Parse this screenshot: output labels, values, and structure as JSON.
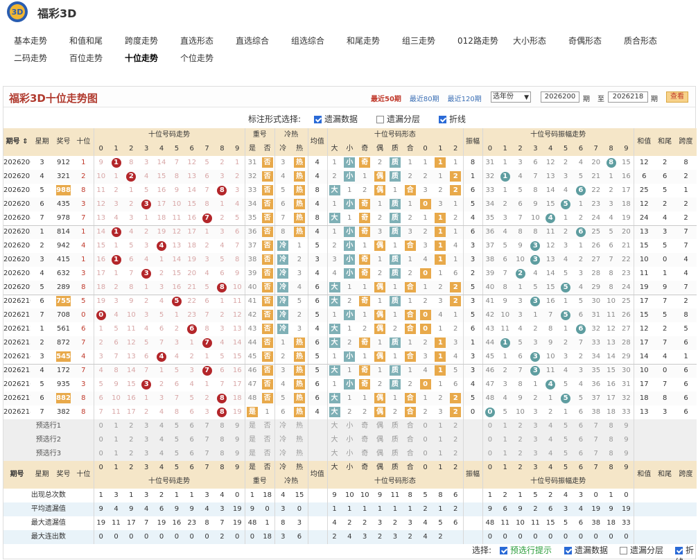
{
  "site": {
    "title": "福彩3D"
  },
  "nav": {
    "row1": [
      "基本走势",
      "和值和尾",
      "跨度走势",
      "直选形态",
      "直选综合",
      "组选综合",
      "和尾走势",
      "组三走势",
      "012路走势",
      "大小形态",
      "奇偶形态",
      "质合形态"
    ],
    "row2": [
      "二码走势",
      "百位走势",
      "十位走势",
      "个位走势"
    ],
    "active": "十位走势"
  },
  "panel": {
    "title": "福彩3D十位走势图",
    "periods": [
      "最近50期",
      "最近80期",
      "最近120期"
    ],
    "selected_period": "最近50期",
    "year_select": "选年份",
    "start": "2026200",
    "end": "2026218",
    "label_qi": "期",
    "label_to": "至",
    "query": "查看"
  },
  "options": {
    "label": "标注形式选择:",
    "items": [
      {
        "label": "遗漏数据",
        "checked": true
      },
      {
        "label": "遗漏分层",
        "checked": false
      },
      {
        "label": "折线",
        "checked": true
      }
    ]
  },
  "header": {
    "qihao": "期号",
    "week": "星期",
    "prize": "奖号",
    "ten": "十位",
    "trend": "十位号码走势",
    "chong": "重号",
    "shi": "是",
    "fou": "否",
    "lengre": "冷热",
    "leng": "冷",
    "re": "热",
    "avg": "均值",
    "shape": "十位号码形态",
    "da": "大",
    "xiao": "小",
    "ji": "奇",
    "ou": "偶",
    "zhi": "质",
    "he": "合",
    "amp": "振幅",
    "amptrend": "十位号码振幅走势",
    "sum": "和值",
    "tail": "和尾",
    "span": "跨度"
  },
  "digits": [
    "0",
    "1",
    "2",
    "3",
    "4",
    "5",
    "6",
    "7",
    "8",
    "9"
  ],
  "d012": [
    "0",
    "1",
    "2"
  ],
  "rows": [
    {
      "q": "2026200",
      "w": "3",
      "n": "912",
      "t": "1",
      "miss": [
        "9",
        "1",
        "8",
        "3",
        "14",
        "7",
        "12",
        "5",
        "2",
        "1"
      ],
      "ch": [
        "31",
        "否"
      ],
      "lr": [
        "3",
        "热"
      ],
      "avg": "4",
      "dx": [
        "1",
        "小"
      ],
      "jo": [
        "奇",
        "2"
      ],
      "zh": [
        "质",
        "1"
      ],
      "r012": [
        "1",
        "1",
        "1"
      ],
      "amp": "8",
      "am": [
        "31",
        "1",
        "3",
        "6",
        "12",
        "2",
        "4",
        "20",
        "8",
        "15"
      ],
      "sum": "12",
      "tail": "2",
      "span": "8"
    },
    {
      "q": "2026201",
      "w": "4",
      "n": "321",
      "t": "2",
      "miss": [
        "10",
        "1",
        "2",
        "4",
        "15",
        "8",
        "13",
        "6",
        "3",
        "2"
      ],
      "ch": [
        "32",
        "否"
      ],
      "lr": [
        "4",
        "热"
      ],
      "avg": "4",
      "dx": [
        "2",
        "小"
      ],
      "jo": [
        "1",
        "偶"
      ],
      "zh": [
        "质",
        "2"
      ],
      "r012": [
        "2",
        "1",
        "2"
      ],
      "amp": "1",
      "am": [
        "32",
        "1",
        "4",
        "7",
        "13",
        "3",
        "5",
        "21",
        "1",
        "16"
      ],
      "sum": "6",
      "tail": "6",
      "span": "2"
    },
    {
      "q": "2026202",
      "w": "5",
      "n": "988",
      "t": "8",
      "miss": [
        "11",
        "2",
        "1",
        "5",
        "16",
        "9",
        "14",
        "7",
        "8",
        "3"
      ],
      "ch": [
        "33",
        "否"
      ],
      "lr": [
        "5",
        "热"
      ],
      "avg": "8",
      "dx": [
        "大",
        "1"
      ],
      "jo": [
        "2",
        "偶"
      ],
      "zh": [
        "1",
        "合"
      ],
      "r012": [
        "3",
        "2",
        "2"
      ],
      "amp": "6",
      "am": [
        "33",
        "1",
        "5",
        "8",
        "14",
        "4",
        "6",
        "22",
        "2",
        "17"
      ],
      "sum": "25",
      "tail": "5",
      "span": "1"
    },
    {
      "q": "2026203",
      "w": "6",
      "n": "435",
      "t": "3",
      "miss": [
        "12",
        "3",
        "2",
        "3",
        "17",
        "10",
        "15",
        "8",
        "1",
        "4"
      ],
      "ch": [
        "34",
        "否"
      ],
      "lr": [
        "6",
        "热"
      ],
      "avg": "4",
      "dx": [
        "1",
        "小"
      ],
      "jo": [
        "奇",
        "1"
      ],
      "zh": [
        "质",
        "1"
      ],
      "r012": [
        "0",
        "3",
        "1"
      ],
      "amp": "5",
      "am": [
        "34",
        "2",
        "6",
        "9",
        "15",
        "5",
        "1",
        "23",
        "3",
        "18"
      ],
      "sum": "12",
      "tail": "2",
      "span": "2"
    },
    {
      "q": "2026204",
      "w": "7",
      "n": "978",
      "t": "7",
      "miss": [
        "13",
        "4",
        "3",
        "1",
        "18",
        "11",
        "16",
        "7",
        "2",
        "5"
      ],
      "ch": [
        "35",
        "否"
      ],
      "lr": [
        "7",
        "热"
      ],
      "avg": "8",
      "dx": [
        "大",
        "1"
      ],
      "jo": [
        "奇",
        "2"
      ],
      "zh": [
        "质",
        "2"
      ],
      "r012": [
        "1",
        "1",
        "2"
      ],
      "amp": "4",
      "am": [
        "35",
        "3",
        "7",
        "10",
        "4",
        "1",
        "2",
        "24",
        "4",
        "19"
      ],
      "sum": "24",
      "tail": "4",
      "span": "2"
    },
    {
      "q": "2026205",
      "w": "1",
      "n": "814",
      "t": "1",
      "miss": [
        "14",
        "1",
        "4",
        "2",
        "19",
        "12",
        "17",
        "1",
        "3",
        "6"
      ],
      "ch": [
        "36",
        "否"
      ],
      "lr": [
        "8",
        "热"
      ],
      "avg": "4",
      "dx": [
        "1",
        "小"
      ],
      "jo": [
        "奇",
        "3"
      ],
      "zh": [
        "质",
        "3"
      ],
      "r012": [
        "2",
        "1",
        "1"
      ],
      "amp": "6",
      "am": [
        "36",
        "4",
        "8",
        "8",
        "11",
        "2",
        "6",
        "25",
        "5",
        "20"
      ],
      "sum": "13",
      "tail": "3",
      "span": "7"
    },
    {
      "q": "2026206",
      "w": "2",
      "n": "942",
      "t": "4",
      "miss": [
        "15",
        "1",
        "5",
        "3",
        "4",
        "13",
        "18",
        "2",
        "4",
        "7"
      ],
      "ch": [
        "37",
        "否"
      ],
      "lr": [
        "冷",
        "1"
      ],
      "avg": "5",
      "dx": [
        "2",
        "小"
      ],
      "jo": [
        "1",
        "偶"
      ],
      "zh": [
        "1",
        "合"
      ],
      "r012": [
        "3",
        "1",
        "4"
      ],
      "amp": "3",
      "am": [
        "37",
        "5",
        "9",
        "3",
        "12",
        "3",
        "1",
        "26",
        "6",
        "21"
      ],
      "sum": "15",
      "tail": "5",
      "span": "7"
    },
    {
      "q": "2026207",
      "w": "3",
      "n": "415",
      "t": "1",
      "miss": [
        "16",
        "1",
        "6",
        "4",
        "1",
        "14",
        "19",
        "3",
        "5",
        "8"
      ],
      "ch": [
        "38",
        "否"
      ],
      "lr": [
        "冷",
        "2"
      ],
      "avg": "3",
      "dx": [
        "3",
        "小"
      ],
      "jo": [
        "奇",
        "1"
      ],
      "zh": [
        "质",
        "1"
      ],
      "r012": [
        "4",
        "1",
        "1"
      ],
      "amp": "3",
      "am": [
        "38",
        "6",
        "10",
        "3",
        "13",
        "4",
        "2",
        "27",
        "7",
        "22"
      ],
      "sum": "10",
      "tail": "0",
      "span": "4"
    },
    {
      "q": "2026208",
      "w": "4",
      "n": "632",
      "t": "3",
      "miss": [
        "17",
        "1",
        "7",
        "3",
        "2",
        "15",
        "20",
        "4",
        "6",
        "9"
      ],
      "ch": [
        "39",
        "否"
      ],
      "lr": [
        "冷",
        "3"
      ],
      "avg": "4",
      "dx": [
        "4",
        "小"
      ],
      "jo": [
        "奇",
        "2"
      ],
      "zh": [
        "质",
        "2"
      ],
      "r012": [
        "0",
        "1",
        "6"
      ],
      "amp": "2",
      "am": [
        "39",
        "7",
        "2",
        "4",
        "14",
        "5",
        "3",
        "28",
        "8",
        "23"
      ],
      "sum": "11",
      "tail": "1",
      "span": "4"
    },
    {
      "q": "2026209",
      "w": "5",
      "n": "289",
      "t": "8",
      "miss": [
        "18",
        "2",
        "8",
        "1",
        "3",
        "16",
        "21",
        "5",
        "8",
        "10"
      ],
      "ch": [
        "40",
        "否"
      ],
      "lr": [
        "冷",
        "4"
      ],
      "avg": "6",
      "dx": [
        "大",
        "1"
      ],
      "jo": [
        "1",
        "偶"
      ],
      "zh": [
        "1",
        "合"
      ],
      "r012": [
        "1",
        "2",
        "2"
      ],
      "amp": "5",
      "am": [
        "40",
        "8",
        "1",
        "5",
        "15",
        "5",
        "4",
        "29",
        "8",
        "24"
      ],
      "sum": "19",
      "tail": "9",
      "span": "7"
    },
    {
      "q": "2026210",
      "w": "6",
      "n": "755",
      "t": "5",
      "miss": [
        "19",
        "3",
        "9",
        "2",
        "4",
        "5",
        "22",
        "6",
        "1",
        "11"
      ],
      "ch": [
        "41",
        "否"
      ],
      "lr": [
        "冷",
        "5"
      ],
      "avg": "6",
      "dx": [
        "大",
        "2"
      ],
      "jo": [
        "奇",
        "1"
      ],
      "zh": [
        "质",
        "1"
      ],
      "r012": [
        "2",
        "3",
        "2"
      ],
      "amp": "3",
      "am": [
        "41",
        "9",
        "3",
        "3",
        "16",
        "1",
        "5",
        "30",
        "10",
        "25"
      ],
      "sum": "17",
      "tail": "7",
      "span": "2"
    },
    {
      "q": "2026211",
      "w": "7",
      "n": "708",
      "t": "0",
      "miss": [
        "0",
        "4",
        "10",
        "3",
        "5",
        "1",
        "23",
        "7",
        "2",
        "12"
      ],
      "ch": [
        "42",
        "否"
      ],
      "lr": [
        "冷",
        "2"
      ],
      "avg": "5",
      "dx": [
        "1",
        "小"
      ],
      "jo": [
        "1",
        "偶"
      ],
      "zh": [
        "1",
        "合"
      ],
      "r012": [
        "0",
        "4",
        "1"
      ],
      "amp": "5",
      "am": [
        "42",
        "10",
        "3",
        "1",
        "7",
        "5",
        "6",
        "31",
        "11",
        "26"
      ],
      "sum": "15",
      "tail": "5",
      "span": "8"
    },
    {
      "q": "2026212",
      "w": "1",
      "n": "561",
      "t": "6",
      "miss": [
        "1",
        "5",
        "11",
        "4",
        "6",
        "2",
        "6",
        "8",
        "3",
        "13"
      ],
      "ch": [
        "43",
        "否"
      ],
      "lr": [
        "冷",
        "3"
      ],
      "avg": "4",
      "dx": [
        "大",
        "1"
      ],
      "jo": [
        "2",
        "偶"
      ],
      "zh": [
        "2",
        "合"
      ],
      "r012": [
        "1",
        "1",
        "2"
      ],
      "amp": "6",
      "am": [
        "43",
        "11",
        "4",
        "2",
        "8",
        "1",
        "6",
        "32",
        "12",
        "27"
      ],
      "sum": "12",
      "tail": "2",
      "span": "5"
    },
    {
      "q": "2026213",
      "w": "2",
      "n": "872",
      "t": "7",
      "miss": [
        "2",
        "6",
        "12",
        "5",
        "7",
        "3",
        "1",
        "7",
        "4",
        "14"
      ],
      "ch": [
        "44",
        "否"
      ],
      "lr": [
        "1",
        "热"
      ],
      "avg": "6",
      "dx": [
        "大",
        "2"
      ],
      "jo": [
        "奇",
        "1"
      ],
      "zh": [
        "质",
        "1"
      ],
      "r012": [
        "2",
        "1",
        "3"
      ],
      "amp": "1",
      "am": [
        "44",
        "1",
        "5",
        "3",
        "9",
        "2",
        "7",
        "33",
        "13",
        "28"
      ],
      "sum": "17",
      "tail": "7",
      "span": "6"
    },
    {
      "q": "2026214",
      "w": "3",
      "n": "545",
      "t": "4",
      "miss": [
        "3",
        "7",
        "13",
        "6",
        "4",
        "4",
        "2",
        "1",
        "5",
        "15"
      ],
      "ch": [
        "45",
        "否"
      ],
      "lr": [
        "2",
        "热"
      ],
      "avg": "5",
      "dx": [
        "1",
        "小"
      ],
      "jo": [
        "1",
        "偶"
      ],
      "zh": [
        "1",
        "合"
      ],
      "r012": [
        "3",
        "1",
        "4"
      ],
      "amp": "3",
      "am": [
        "45",
        "1",
        "6",
        "3",
        "10",
        "3",
        "2",
        "34",
        "14",
        "29"
      ],
      "sum": "14",
      "tail": "4",
      "span": "1"
    },
    {
      "q": "2026215",
      "w": "4",
      "n": "172",
      "t": "7",
      "miss": [
        "4",
        "8",
        "14",
        "7",
        "1",
        "5",
        "3",
        "7",
        "6",
        "16"
      ],
      "ch": [
        "46",
        "否"
      ],
      "lr": [
        "3",
        "热"
      ],
      "avg": "5",
      "dx": [
        "大",
        "1"
      ],
      "jo": [
        "奇",
        "1"
      ],
      "zh": [
        "质",
        "1"
      ],
      "r012": [
        "4",
        "1",
        "5"
      ],
      "amp": "3",
      "am": [
        "46",
        "2",
        "7",
        "3",
        "11",
        "4",
        "3",
        "35",
        "15",
        "30"
      ],
      "sum": "10",
      "tail": "0",
      "span": "6"
    },
    {
      "q": "2026216",
      "w": "5",
      "n": "935",
      "t": "3",
      "miss": [
        "5",
        "9",
        "15",
        "3",
        "2",
        "6",
        "4",
        "1",
        "7",
        "17"
      ],
      "ch": [
        "47",
        "否"
      ],
      "lr": [
        "4",
        "热"
      ],
      "avg": "6",
      "dx": [
        "1",
        "小"
      ],
      "jo": [
        "奇",
        "2"
      ],
      "zh": [
        "质",
        "2"
      ],
      "r012": [
        "0",
        "1",
        "6"
      ],
      "amp": "4",
      "am": [
        "47",
        "3",
        "8",
        "1",
        "4",
        "5",
        "4",
        "36",
        "16",
        "31"
      ],
      "sum": "17",
      "tail": "7",
      "span": "6"
    },
    {
      "q": "2026217",
      "w": "6",
      "n": "882",
      "t": "8",
      "miss": [
        "6",
        "10",
        "16",
        "1",
        "3",
        "7",
        "5",
        "2",
        "8",
        "18"
      ],
      "ch": [
        "48",
        "否"
      ],
      "lr": [
        "5",
        "热"
      ],
      "avg": "6",
      "dx": [
        "大",
        "1"
      ],
      "jo": [
        "1",
        "偶"
      ],
      "zh": [
        "1",
        "合"
      ],
      "r012": [
        "1",
        "2",
        "2"
      ],
      "amp": "5",
      "am": [
        "48",
        "4",
        "9",
        "2",
        "1",
        "5",
        "5",
        "37",
        "17",
        "32"
      ],
      "sum": "18",
      "tail": "8",
      "span": "6"
    },
    {
      "q": "2026218",
      "w": "7",
      "n": "382",
      "t": "8",
      "miss": [
        "7",
        "11",
        "17",
        "2",
        "4",
        "8",
        "6",
        "3",
        "8",
        "19"
      ],
      "ch": [
        "是",
        "1"
      ],
      "lr": [
        "6",
        "热"
      ],
      "avg": "4",
      "dx": [
        "大",
        "2"
      ],
      "jo": [
        "2",
        "偶"
      ],
      "zh": [
        "2",
        "合"
      ],
      "r012": [
        "2",
        "3",
        "2"
      ],
      "amp": "0",
      "am": [
        "0",
        "5",
        "10",
        "3",
        "2",
        "1",
        "6",
        "38",
        "18",
        "33"
      ],
      "sum": "13",
      "tail": "3",
      "span": "6"
    }
  ],
  "pre": [
    "预选行1",
    "预选行2",
    "预选行3"
  ],
  "stats": [
    {
      "label": "出现总次数",
      "v": [
        "1",
        "3",
        "1",
        "3",
        "2",
        "1",
        "1",
        "3",
        "4",
        "0",
        "1",
        "18",
        "4",
        "15",
        "",
        "9",
        "10",
        "10",
        "9",
        "11",
        "8",
        "5",
        "8",
        "6",
        "",
        "1",
        "2",
        "1",
        "5",
        "2",
        "4",
        "3",
        "0",
        "1",
        "0"
      ]
    },
    {
      "label": "平均遗漏值",
      "v": [
        "9",
        "4",
        "9",
        "4",
        "6",
        "9",
        "9",
        "4",
        "3",
        "19",
        "9",
        "0",
        "3",
        "0",
        "",
        "1",
        "1",
        "1",
        "1",
        "1",
        "1",
        "2",
        "1",
        "2",
        "",
        "9",
        "6",
        "9",
        "2",
        "6",
        "3",
        "4",
        "19",
        "9",
        "19"
      ]
    },
    {
      "label": "最大遗漏值",
      "v": [
        "19",
        "11",
        "17",
        "7",
        "19",
        "16",
        "23",
        "8",
        "7",
        "19",
        "48",
        "1",
        "8",
        "3",
        "",
        "4",
        "2",
        "2",
        "3",
        "2",
        "3",
        "4",
        "5",
        "6",
        "",
        "48",
        "11",
        "10",
        "11",
        "15",
        "5",
        "6",
        "38",
        "18",
        "33"
      ]
    },
    {
      "label": "最大连出数",
      "v": [
        "0",
        "0",
        "0",
        "0",
        "0",
        "0",
        "0",
        "0",
        "2",
        "0",
        "0",
        "18",
        "3",
        "6",
        "",
        "2",
        "4",
        "3",
        "2",
        "3",
        "2",
        "4",
        "2",
        "",
        "",
        "0",
        "0",
        "0",
        "0",
        "0",
        "0",
        "0",
        "0",
        "0",
        "0"
      ]
    }
  ],
  "footer": {
    "label": "选择:",
    "items": [
      {
        "label": "预选行提示",
        "checked": true,
        "green": true
      },
      {
        "label": "遗漏数据",
        "checked": true
      },
      {
        "label": "遗漏分层",
        "checked": false
      },
      {
        "label": "折线",
        "checked": true
      }
    ]
  },
  "colors": {
    "red": "#b3262a",
    "teal": "#5e9da0",
    "orange": "#e8a94a",
    "header": "#f5e6c8",
    "title": "#b03a2e"
  }
}
